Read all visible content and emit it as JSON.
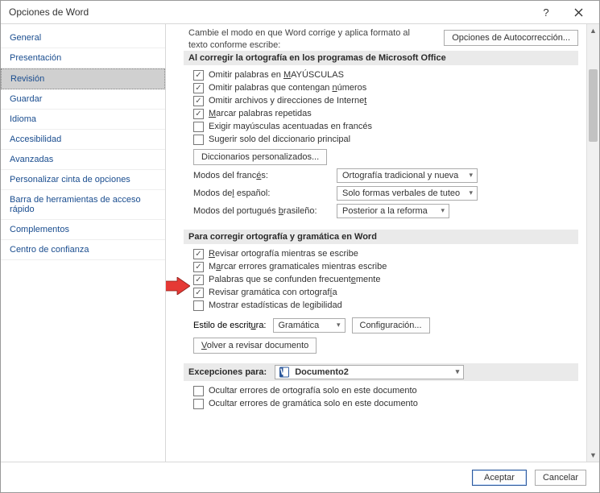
{
  "window": {
    "title": "Opciones de Word"
  },
  "sidebar": {
    "items": [
      {
        "label": "General"
      },
      {
        "label": "Presentación"
      },
      {
        "label": "Revisión"
      },
      {
        "label": "Guardar"
      },
      {
        "label": "Idioma"
      },
      {
        "label": "Accesibilidad"
      },
      {
        "label": "Avanzadas"
      },
      {
        "label": "Personalizar cinta de opciones"
      },
      {
        "label": "Barra de herramientas de acceso rápido"
      },
      {
        "label": "Complementos"
      },
      {
        "label": "Centro de confianza"
      }
    ],
    "selected_index": 2
  },
  "main": {
    "intro_line1": "Cambie el modo en que Word corrige y aplica formato al",
    "intro_line2": "texto conforme escribe:",
    "autocorrect_button": "Opciones de Autocorrección...",
    "section1": {
      "title": "Al corregir la ortografía en los programas de Microsoft Office",
      "checks": [
        {
          "checked": true,
          "pre": "Omitir palabras en ",
          "u": "M",
          "post": "AYÚSCULAS"
        },
        {
          "checked": true,
          "pre": "Omitir palabras que contengan ",
          "u": "n",
          "post": "úmeros"
        },
        {
          "checked": true,
          "pre": "Omitir archivos y direcciones de Interne",
          "u": "t",
          "post": ""
        },
        {
          "checked": true,
          "pre": "",
          "u": "M",
          "post": "arcar palabras repetidas"
        },
        {
          "checked": false,
          "pre": "Exigir mayúsculas acentuadas en francés",
          "u": "",
          "post": ""
        },
        {
          "checked": false,
          "pre": "Sugerir solo del diccionario principal",
          "u": "",
          "post": ""
        }
      ],
      "dict_button": "Diccionarios personalizados...",
      "rows": [
        {
          "label_pre": "Modos del franc",
          "label_u": "é",
          "label_post": "s:",
          "value": "Ortografía tradicional y nueva"
        },
        {
          "label_pre": "Modos de",
          "label_u": "l",
          "label_post": " español:",
          "value": "Solo formas verbales de tuteo"
        },
        {
          "label_pre": "Modos del portugués ",
          "label_u": "b",
          "label_post": "rasileño:",
          "value": "Posterior a la reforma"
        }
      ]
    },
    "section2": {
      "title": "Para corregir ortografía y gramática en Word",
      "checks": [
        {
          "checked": true,
          "pre": "",
          "u": "R",
          "post": "evisar ortografía mientras se escribe"
        },
        {
          "checked": true,
          "pre": "M",
          "u": "a",
          "post": "rcar errores gramaticales mientras escribe"
        },
        {
          "checked": true,
          "pre": "Palabras que se confunden frecuent",
          "u": "e",
          "post": "mente"
        },
        {
          "checked": true,
          "pre": "Revisar gramática con ortograf",
          "u": "í",
          "post": "a"
        },
        {
          "checked": false,
          "pre": "Mostrar estadísticas de legibilidad",
          "u": "",
          "post": ""
        }
      ],
      "style_label_pre": "Estilo de escrit",
      "style_label_u": "u",
      "style_label_post": "ra:",
      "style_value": "Gramática",
      "config_button": "Configuración...",
      "recheck_button_pre": "",
      "recheck_button_u": "V",
      "recheck_button_post": "olver a revisar documento"
    },
    "section3": {
      "title": "Excepciones para:",
      "doc_value": "Documento2",
      "checks": [
        {
          "checked": false,
          "pre": "Ocultar errores de ortografía solo en este documento"
        },
        {
          "checked": false,
          "pre": "Ocultar errores de gramática solo en este documento"
        }
      ]
    }
  },
  "footer": {
    "ok": "Aceptar",
    "cancel": "Cancelar"
  }
}
